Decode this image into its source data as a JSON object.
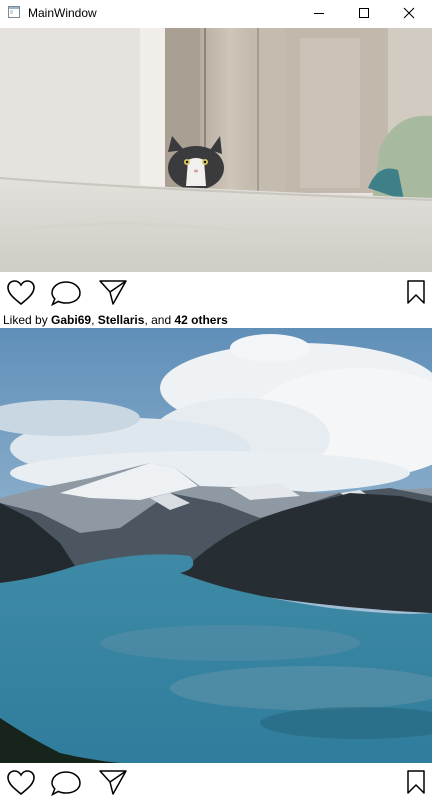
{
  "window": {
    "title": "MainWindow",
    "controls": [
      "minimize-icon",
      "maximize-icon",
      "close-icon"
    ]
  },
  "feed": {
    "posts": [
      {
        "image": "cat-peeking-over-bed-photo",
        "actions": [
          "heart-icon",
          "comment-icon",
          "share-icon",
          "bookmark-icon"
        ],
        "likes": {
          "prefix": "Liked by ",
          "user1": "Gabi69",
          "sep1": ", ",
          "user2": "Stellaris",
          "sep2": ", and ",
          "others": "42 others"
        }
      },
      {
        "image": "mountain-lake-landscape-photo",
        "actions": [
          "heart-icon",
          "comment-icon",
          "share-icon",
          "bookmark-icon"
        ]
      }
    ]
  }
}
